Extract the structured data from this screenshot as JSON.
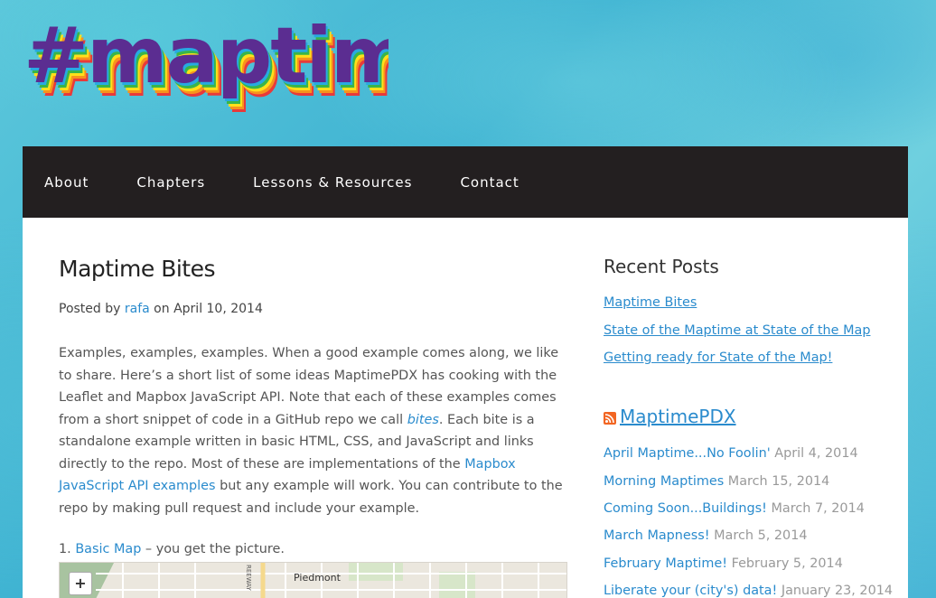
{
  "site": {
    "logo_text": "#maptime!"
  },
  "nav": {
    "items": [
      {
        "label": "About"
      },
      {
        "label": "Chapters"
      },
      {
        "label": "Lessons & Resources"
      },
      {
        "label": "Contact"
      }
    ]
  },
  "post": {
    "title": "Maptime Bites",
    "byline_prefix": "Posted by",
    "author": "rafa",
    "byline_on": "on",
    "date": "April 10, 2014",
    "para_1": "Examples, examples, examples. When a good example comes along, we like to share. Here’s a short list of some ideas MaptimePDX has cooking with the Leaflet and Mapbox JavaScript API. Note that each of these examples comes from a short snippet of code in a GitHub repo we call ",
    "bites_link": "bites",
    "para_2": ". Each bite is a standalone example written in basic HTML, CSS, and JavaScript and links directly to the repo. Most of these are implementations of the ",
    "mapbox_link": "Mapbox JavaScript API examples",
    "para_3": " but any example will work. You can contribute to the repo by making pull request and include your example.",
    "list": {
      "number": "1.",
      "link": "Basic Map",
      "rest": " – you get the picture."
    },
    "map": {
      "zoom_in": "+",
      "place_label": "Piedmont",
      "road_label": "REEWAY"
    }
  },
  "sidebar": {
    "recent_title": "Recent Posts",
    "recent_posts": [
      {
        "title": "Maptime Bites"
      },
      {
        "title": "State of the Maptime at State of the Map"
      },
      {
        "title": "Getting ready for State of the Map!"
      }
    ],
    "feed_title": "MaptimePDX",
    "feed_icon": "rss-icon",
    "feed_items": [
      {
        "title": "April Maptime...No Foolin'",
        "date": "April 4, 2014"
      },
      {
        "title": "Morning Maptimes",
        "date": "March 15, 2014"
      },
      {
        "title": "Coming Soon...Buildings!",
        "date": "March 7, 2014"
      },
      {
        "title": "March Mapness!",
        "date": "March 5, 2014"
      },
      {
        "title": "February Maptime!",
        "date": "February 5, 2014"
      },
      {
        "title": "Liberate your (city's) data!",
        "date": "January 23, 2014"
      }
    ]
  },
  "colors": {
    "nav_bg": "#231f20",
    "link": "#2a8bcd",
    "logo_purple": "#5b2d91"
  }
}
